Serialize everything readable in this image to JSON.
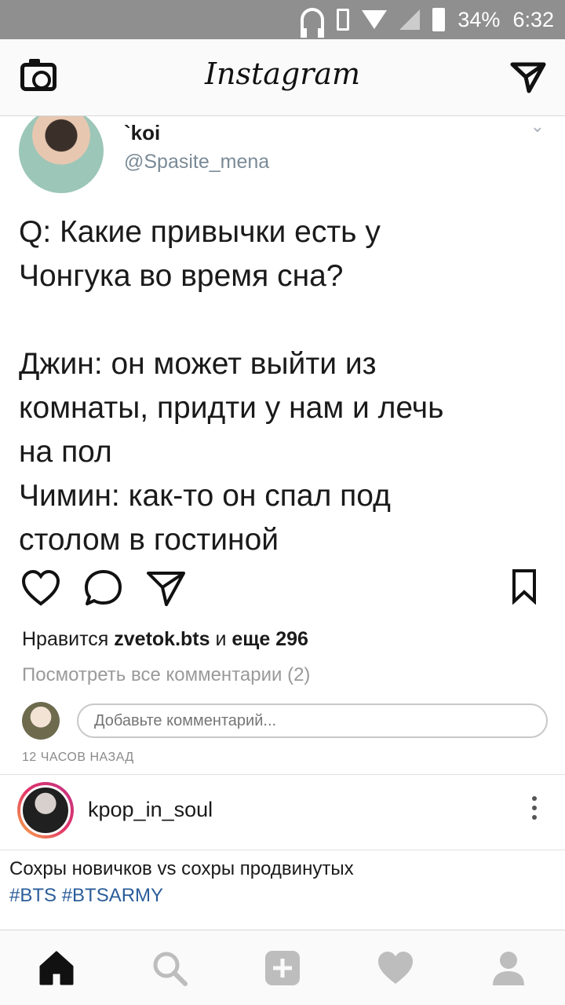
{
  "status_bar": {
    "battery": "34%",
    "time": "6:32"
  },
  "header": {
    "logo": "Instagram"
  },
  "tweet": {
    "name": "`koi",
    "handle": "@Spasite_mena",
    "text": "Q: Какие привычки есть у\nЧонгука во время сна?\n\nДжин: он может выйти из\nкомнаты, придти у нам и лечь\nна пол\nЧимин: как-то он спал под\nстолом в гостиной"
  },
  "likes": {
    "prefix": "Нравится ",
    "user": "zvetok.bts",
    "mid": " и ",
    "count": "еще 296"
  },
  "view_comments": "Посмотреть все комментарии (2)",
  "comment_input": {
    "placeholder": "Добавьте комментарий..."
  },
  "time_ago": "12 ЧАСОВ НАЗАД",
  "post2": {
    "username": "kpop_in_soul",
    "caption": "Сохры новичков vs сохры продвинутых",
    "hashtags": "#BTS #BTSARMY"
  },
  "icons": [
    "camera-icon",
    "direct-send-icon",
    "heart-icon",
    "comment-icon",
    "share-icon",
    "bookmark-icon",
    "more-icon",
    "home-icon",
    "search-icon",
    "add-icon",
    "activity-icon",
    "profile-icon"
  ]
}
